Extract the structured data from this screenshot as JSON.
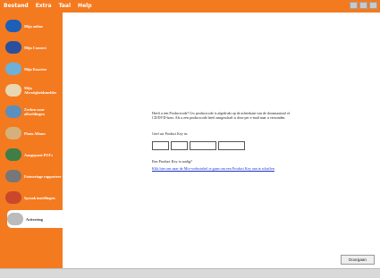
{
  "menu": [
    "Bestand",
    "Extra",
    "Taal",
    "Help"
  ],
  "sidebar": {
    "items": [
      {
        "label": "Mijn online",
        "icon": "network-icon",
        "color": "#1d5fb6"
      },
      {
        "label": "Mijn Connect",
        "icon": "globe-connect-icon",
        "color": "#2a4f9e"
      },
      {
        "label": "Mijn Kaarten",
        "icon": "maps-icon",
        "color": "#6fb0d8"
      },
      {
        "label": "Mijn Afwezigheidsmelder",
        "icon": "envelope-icon",
        "color": "#e8d7b0"
      },
      {
        "label": "Zoeken naar afbeeldingen",
        "icon": "picture-search-icon",
        "color": "#5b8fbd"
      },
      {
        "label": "Photo Album",
        "icon": "photo-album-icon",
        "color": "#d5b07a"
      },
      {
        "label": "Aangepaste POI's",
        "icon": "poi-icon",
        "color": "#3f7e47"
      },
      {
        "label": "Fotoseringe rapporteer",
        "icon": "keyboard-icon",
        "color": "#777777"
      },
      {
        "label": "Spraak instellingen",
        "icon": "speech-icon",
        "color": "#c9472b"
      },
      {
        "label": "Activering",
        "icon": "activation-icon",
        "color": "#bbbbbb"
      }
    ],
    "active_index": 9
  },
  "main": {
    "intro": "Heeft u een Productcode? Uw productcode is afgedrukt op de achterkant van de doosmaatstaf of CD/DVD-hoes. Als u een productcode heeft aangeschaft is deze per e-mail naar u verzonden.",
    "prompt": "Geef uw Product Key in:",
    "key_fields": [
      "",
      "",
      "",
      ""
    ],
    "question": "Een Product Key is nodig?",
    "link": "Klik hier om naar de Mio-webwinkel te gaan om een Product Key aan te schaffen",
    "continue_label": "Doorgaan"
  }
}
